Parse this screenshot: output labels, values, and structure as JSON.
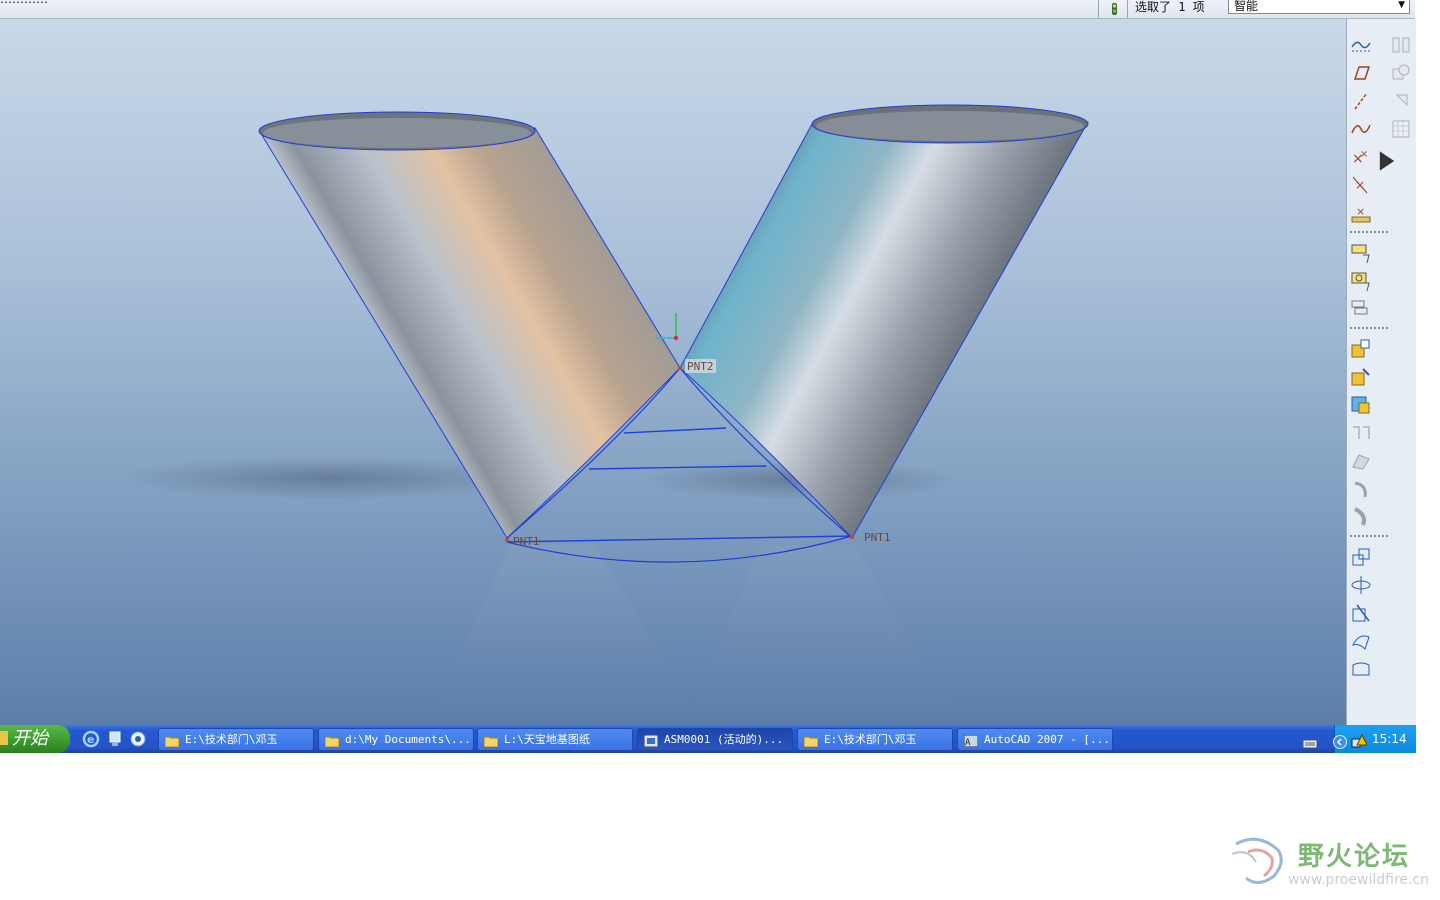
{
  "top_bar": {
    "left_fragment": "…………",
    "filter_icon": "traffic-light-icon",
    "selection_status": "选取了 1 项",
    "filter_value": "智能"
  },
  "viewport": {
    "points": {
      "pnt2": "PNT2",
      "pnt1_left": "PNT1",
      "pnt1_right": "PNT1"
    },
    "colors": {
      "surface_dark": "#555d66",
      "surface_light": "#c9d2dc",
      "edge": "#1f3fd8",
      "highlight_orange": "#e6bfa0",
      "highlight_cyan": "#6fb6cf"
    }
  },
  "right_toolbar": {
    "tools": [
      "sketch-datum-icon",
      "datum-plane-icon",
      "datum-axis-icon",
      "datum-curve-icon",
      "datum-point-icon",
      "datum-point-offset-icon",
      "datum-point-field-icon",
      "layer-tree-icon",
      "layer-copy-icon",
      "layer-group-icon",
      "component-add-icon",
      "component-package-icon",
      "component-create-icon",
      "mirror-icon",
      "extrude-icon",
      "revolve-icon",
      "sweep-icon",
      "copy-transform-icon",
      "rotate-icon",
      "move-icon",
      "surface-icon",
      "boundary-icon"
    ],
    "side_tools": [
      "mirror-surface-icon",
      "merge-icon",
      "trim-icon",
      "grid-icon"
    ]
  },
  "taskbar": {
    "start_label": "开始",
    "quick_launch": [
      "ie-icon",
      "desktop-icon",
      "media-icon"
    ],
    "tasks": [
      {
        "label": "E:\\技术部门\\邓玉",
        "icon": "folder-icon"
      },
      {
        "label": "d:\\My Documents\\...",
        "icon": "folder-icon"
      },
      {
        "label": "L:\\天宝地基图纸",
        "icon": "folder-icon"
      },
      {
        "label": "ASM0001 (活动的)...",
        "icon": "proe-icon",
        "active": true
      },
      {
        "label": "E:\\技术部门\\邓玉",
        "icon": "folder-icon"
      },
      {
        "label": "AutoCAD 2007 - [...",
        "icon": "autocad-icon"
      }
    ],
    "clock": "15:14"
  },
  "watermark": {
    "title": "野火论坛",
    "url": "www.proewildfire.cn"
  }
}
